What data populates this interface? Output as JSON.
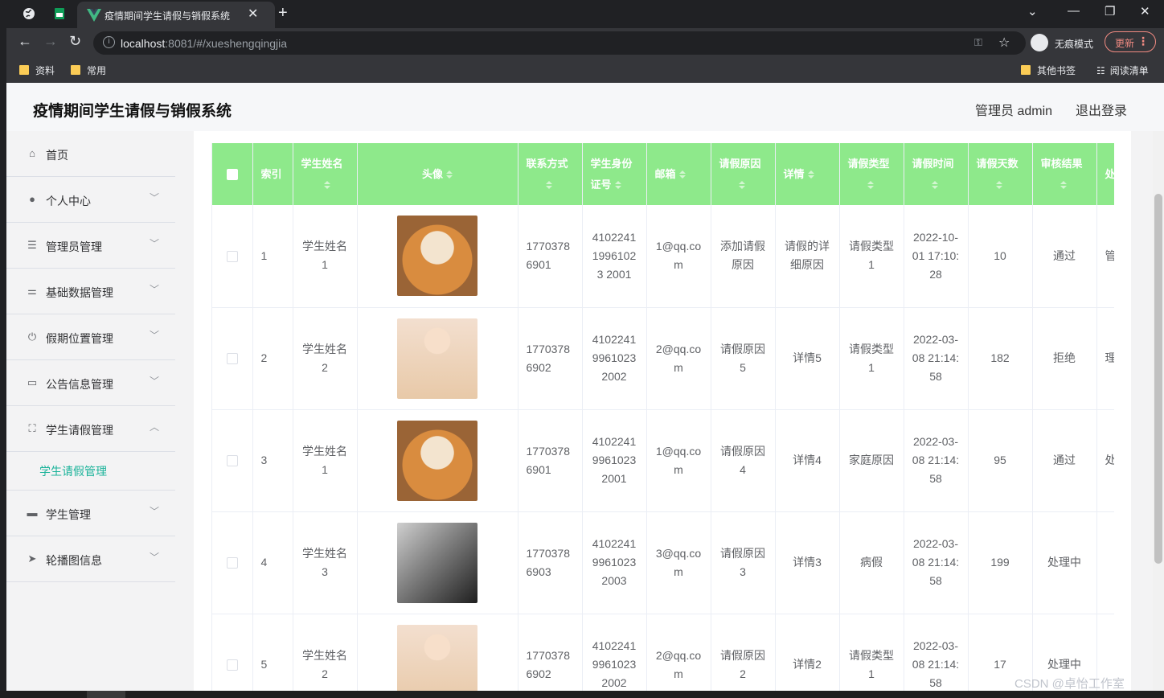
{
  "browser": {
    "tab_title": "疫情期间学生请假与销假系统",
    "url_host": "localhost",
    "url_path": ":8081/#/xueshengqingjia",
    "incognito_label": "无痕模式",
    "update_label": "更新",
    "bookmarks": [
      "资料",
      "常用"
    ],
    "bookmarks_right": [
      "其他书签",
      "阅读清单"
    ]
  },
  "header": {
    "title": "疫情期间学生请假与销假系统",
    "user": "管理员 admin",
    "logout": "退出登录"
  },
  "sidebar": {
    "items": [
      {
        "label": "首页",
        "icon": "home-icon"
      },
      {
        "label": "个人中心",
        "icon": "user-icon"
      },
      {
        "label": "管理员管理",
        "icon": "list-icon"
      },
      {
        "label": "基础数据管理",
        "icon": "sliders-icon"
      },
      {
        "label": "假期位置管理",
        "icon": "power-icon"
      },
      {
        "label": "公告信息管理",
        "icon": "message-icon"
      },
      {
        "label": "学生请假管理",
        "icon": "fullscreen-icon"
      },
      {
        "label": "学生管理",
        "icon": "printer-icon"
      },
      {
        "label": "轮播图信息",
        "icon": "send-icon"
      }
    ],
    "active_sub": "学生请假管理"
  },
  "table": {
    "headers": [
      "索引",
      "学生姓名",
      "头像",
      "联系方式",
      "学生身份证号",
      "邮箱",
      "请假原因",
      "详情",
      "请假类型",
      "请假时间",
      "请假天数",
      "审核结果",
      "处"
    ],
    "rows": [
      {
        "index": "1",
        "name": "学生姓名1",
        "avatar": "dog",
        "phone": "17703786901",
        "idno": "410224119961023 2001",
        "email": "1@qq.com",
        "reason": "添加请假原因",
        "detail": "请假的详细原因",
        "type": "请假类型1",
        "time": "2022-10-01 17:10:28",
        "days": "10",
        "result": "通过",
        "extra": "管白"
      },
      {
        "index": "2",
        "name": "学生姓名2",
        "avatar": "girl",
        "phone": "17703786902",
        "idno": "410224199610232002",
        "email": "2@qq.com",
        "reason": "请假原因5",
        "detail": "详情5",
        "type": "请假类型1",
        "time": "2022-03-08 21:14:58",
        "days": "182",
        "result": "拒绝",
        "extra": "理"
      },
      {
        "index": "3",
        "name": "学生姓名1",
        "avatar": "dog",
        "phone": "17703786901",
        "idno": "410224199610232001",
        "email": "1@qq.com",
        "reason": "请假原因4",
        "detail": "详情4",
        "type": "家庭原因",
        "time": "2022-03-08 21:14:58",
        "days": "95",
        "result": "通过",
        "extra": "处"
      },
      {
        "index": "4",
        "name": "学生姓名3",
        "avatar": "man",
        "phone": "17703786903",
        "idno": "410224199610232003",
        "email": "3@qq.com",
        "reason": "请假原因3",
        "detail": "详情3",
        "type": "病假",
        "time": "2022-03-08 21:14:58",
        "days": "199",
        "result": "处理中",
        "extra": ""
      },
      {
        "index": "5",
        "name": "学生姓名2",
        "avatar": "girl",
        "phone": "17703786902",
        "idno": "410224199610232002",
        "email": "2@qq.com",
        "reason": "请假原因2",
        "detail": "详情2",
        "type": "请假类型1",
        "time": "2022-03-08 21:14:58",
        "days": "17",
        "result": "处理中",
        "extra": ""
      }
    ]
  },
  "watermark": "CSDN @卓怡工作室",
  "colors": {
    "header_green": "#8ee98b",
    "accent": "#1bb39a"
  }
}
